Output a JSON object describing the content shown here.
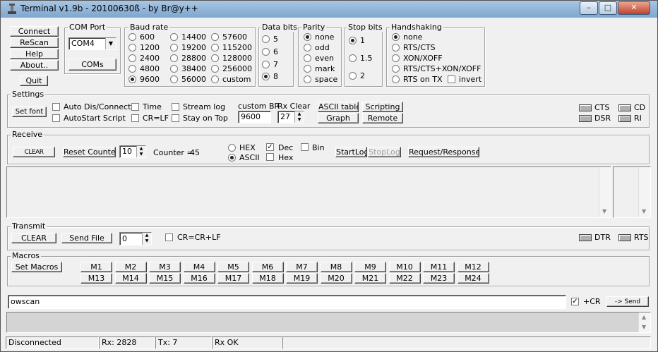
{
  "window": {
    "title": "Terminal v1.9b - 20100630ß - by Br@y++"
  },
  "caption_buttons": {
    "minimize": "–",
    "maximize": "□",
    "close": "✕"
  },
  "left_buttons": [
    "Connect",
    "ReScan",
    "Help",
    "About..",
    "Quit"
  ],
  "com_port": {
    "label": "COM Port",
    "value": "COM4",
    "coms_button": "COMs"
  },
  "baud_rate": {
    "label": "Baud rate",
    "options": [
      "600",
      "1200",
      "2400",
      "4800",
      "9600",
      "14400",
      "19200",
      "28800",
      "38400",
      "56000",
      "57600",
      "115200",
      "128000",
      "256000",
      "custom"
    ],
    "selected": "9600"
  },
  "data_bits": {
    "label": "Data bits",
    "options": [
      "5",
      "6",
      "7",
      "8"
    ],
    "selected": "8"
  },
  "parity": {
    "label": "Parity",
    "options": [
      "none",
      "odd",
      "even",
      "mark",
      "space"
    ],
    "selected": "none"
  },
  "stop_bits": {
    "label": "Stop bits",
    "options": [
      "1",
      "1.5",
      "2"
    ],
    "selected": "1"
  },
  "handshaking": {
    "label": "Handshaking",
    "options": [
      "none",
      "RTS/CTS",
      "XON/XOFF",
      "RTS/CTS+XON/XOFF",
      "RTS on TX"
    ],
    "selected": "none",
    "invert_label": "invert"
  },
  "settings": {
    "label": "Settings",
    "set_font": "Set font",
    "checks": [
      "Auto Dis/Connect",
      "AutoStart Script",
      "Time",
      "CR=LF",
      "Stream log",
      "Stay on Top"
    ],
    "custom_br_label": "custom BR",
    "custom_br_value": "9600",
    "rx_clear_label": "Rx Clear",
    "rx_clear_value": "27",
    "ascii_table": "ASCII table",
    "graph": "Graph",
    "scripting": "Scripting",
    "remote": "Remote",
    "leds": [
      "CTS",
      "CD",
      "DSR",
      "RI"
    ]
  },
  "receive": {
    "label": "Receive",
    "clear_button": "CLEAR",
    "reset_counter": "Reset Counter",
    "counter_spin_value": "10",
    "counter_label": "Counter =",
    "counter_value": "45",
    "hex_label": "HEX",
    "ascii_label": "ASCII",
    "dec_label": "Dec",
    "hex2_label": "Hex",
    "bin_label": "Bin",
    "startlog": "StartLog",
    "stoplog": "StopLog",
    "request_response": "Request/Response"
  },
  "transmit": {
    "label": "Transmit",
    "clear": "CLEAR",
    "send_file": "Send File",
    "spin_value": "0",
    "crlf_label": "CR=CR+LF",
    "leds": [
      "DTR",
      "RTS"
    ]
  },
  "macros": {
    "label": "Macros",
    "set_macros": "Set Macros",
    "row1": [
      "M1",
      "M2",
      "M3",
      "M4",
      "M5",
      "M6",
      "M7",
      "M8",
      "M9",
      "M10",
      "M11",
      "M12"
    ],
    "row2": [
      "M13",
      "M14",
      "M15",
      "M16",
      "M17",
      "M18",
      "M19",
      "M20",
      "M21",
      "M22",
      "M23",
      "M24"
    ]
  },
  "input": {
    "value": "owscan",
    "cr_label": "+CR",
    "send": "-> Send"
  },
  "status": [
    "Disconnected",
    "Rx: 2828",
    "Tx: 7",
    "Rx OK"
  ]
}
